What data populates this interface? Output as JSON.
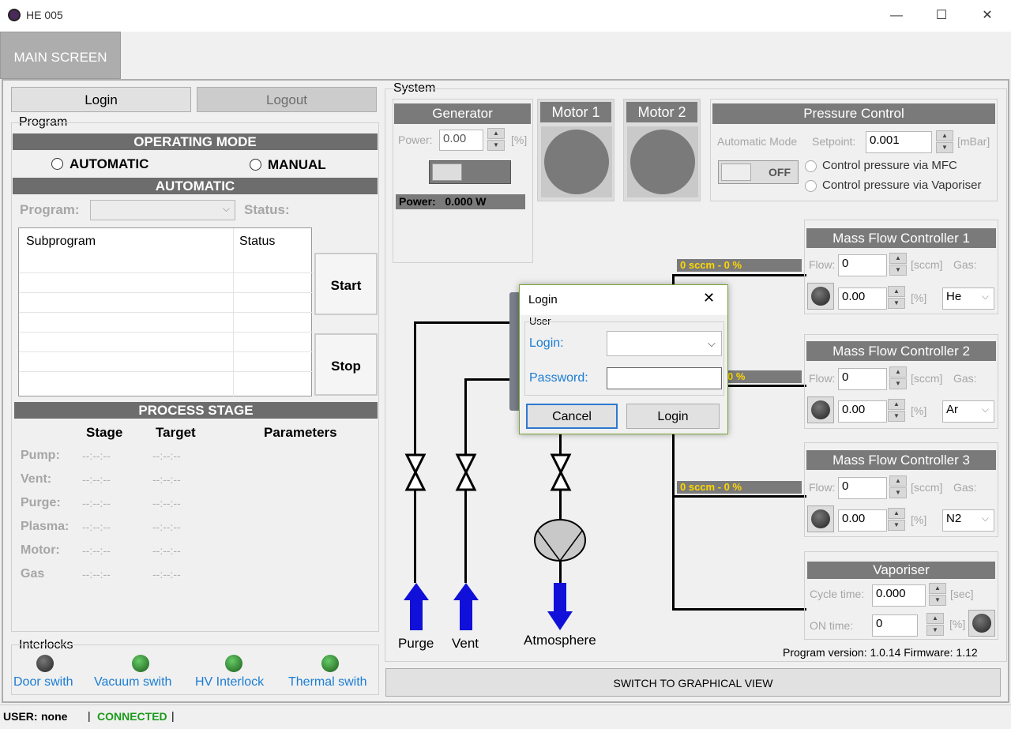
{
  "window": {
    "title": "HE 005",
    "minimize": "—",
    "maximize": "☐",
    "close": "✕"
  },
  "tabs": [
    {
      "label": "MAIN SCREEN"
    }
  ],
  "auth": {
    "login_label": "Login",
    "logout_label": "Logout"
  },
  "program": {
    "group_label": "Program",
    "operating_mode_header": "OPERATING MODE",
    "automatic_label": "AUTOMATIC",
    "manual_label": "MANUAL",
    "automatic_header": "AUTOMATIC",
    "program_label": "Program:",
    "status_label": "Status:",
    "table_headers": [
      "Subprogram",
      "Status"
    ],
    "start_label": "Start",
    "stop_label": "Stop"
  },
  "process_stage": {
    "header": "PROCESS STAGE",
    "columns": [
      "Stage",
      "Target",
      "Parameters"
    ],
    "rows": [
      {
        "name": "Pump:",
        "stage": "--:--:--",
        "target": "--:--:--"
      },
      {
        "name": "Vent:",
        "stage": "--:--:--",
        "target": "--:--:--"
      },
      {
        "name": "Purge:",
        "stage": "--:--:--",
        "target": "--:--:--"
      },
      {
        "name": "Plasma:",
        "stage": "--:--:--",
        "target": "--:--:--"
      },
      {
        "name": "Motor:",
        "stage": "--:--:--",
        "target": "--:--:--"
      },
      {
        "name": "Gas",
        "stage": "--:--:--",
        "target": "--:--:--"
      }
    ]
  },
  "interlocks": {
    "label": "Interlocks",
    "items": [
      {
        "label": "Door swith",
        "state": "off"
      },
      {
        "label": "Vacuum swith",
        "state": "on"
      },
      {
        "label": "HV Interlock",
        "state": "on"
      },
      {
        "label": "Thermal swith",
        "state": "on"
      }
    ]
  },
  "system": {
    "label": "System",
    "generator": {
      "header": "Generator",
      "power_label": "Power:",
      "power_value": "0.00",
      "unit": "[%]",
      "readout": "Power:   0.000 W"
    },
    "motor1": {
      "header": "Motor 1"
    },
    "motor2": {
      "header": "Motor 2"
    },
    "pressure": {
      "header": "Pressure Control",
      "mode_label": "Automatic Mode",
      "setpoint_label": "Setpoint:",
      "setpoint_value": "0.001",
      "unit": "[mBar]",
      "toggle_label": "OFF",
      "option_mfc": "Control pressure via MFC",
      "option_vaporiser": "Control pressure via Vaporiser"
    },
    "mfcs": [
      {
        "header": "Mass Flow Controller 1",
        "flow_label": "Flow:",
        "flow_value": "0",
        "flow_unit": "[sccm]",
        "gas_label": "Gas:",
        "pct_value": "0.00",
        "pct_unit": "[%]",
        "gas": "He",
        "bar_text": "0 sccm - 0 %"
      },
      {
        "header": "Mass Flow Controller 2",
        "flow_label": "Flow:",
        "flow_value": "0",
        "flow_unit": "[sccm]",
        "gas_label": "Gas:",
        "pct_value": "0.00",
        "pct_unit": "[%]",
        "gas": "Ar",
        "bar_text": "0 %"
      },
      {
        "header": "Mass Flow Controller 3",
        "flow_label": "Flow:",
        "flow_value": "0",
        "flow_unit": "[sccm]",
        "gas_label": "Gas:",
        "pct_value": "0.00",
        "pct_unit": "[%]",
        "gas": "N2",
        "bar_text": "0 sccm - 0 %"
      }
    ],
    "vaporiser": {
      "header": "Vaporiser",
      "cycle_label": "Cycle time:",
      "cycle_value": "0.000",
      "cycle_unit": "[sec]",
      "on_label": "ON time:",
      "on_value": "0",
      "on_unit": "[%]"
    },
    "labels": {
      "purge": "Purge",
      "vent": "Vent",
      "atmosphere": "Atmosphere"
    },
    "version": "Program version: 1.0.14 Firmware: 1.12",
    "switch_view": "SWITCH TO GRAPHICAL VIEW"
  },
  "login_dialog": {
    "title": "Login",
    "group_label": "User",
    "login_label": "Login:",
    "login_value": "",
    "password_label": "Password:",
    "password_value": "",
    "cancel_label": "Cancel",
    "ok_label": "Login"
  },
  "statusbar": {
    "user_label": "USER:",
    "user_value": "none",
    "sep1": "|",
    "connection": "CONNECTED",
    "sep2": "|"
  },
  "colors": {
    "accent_blue": "#1b7dd4",
    "connected_green": "#1a9a1a",
    "flow_yellow": "#ffd700",
    "arrow_blue": "#1010d8"
  }
}
